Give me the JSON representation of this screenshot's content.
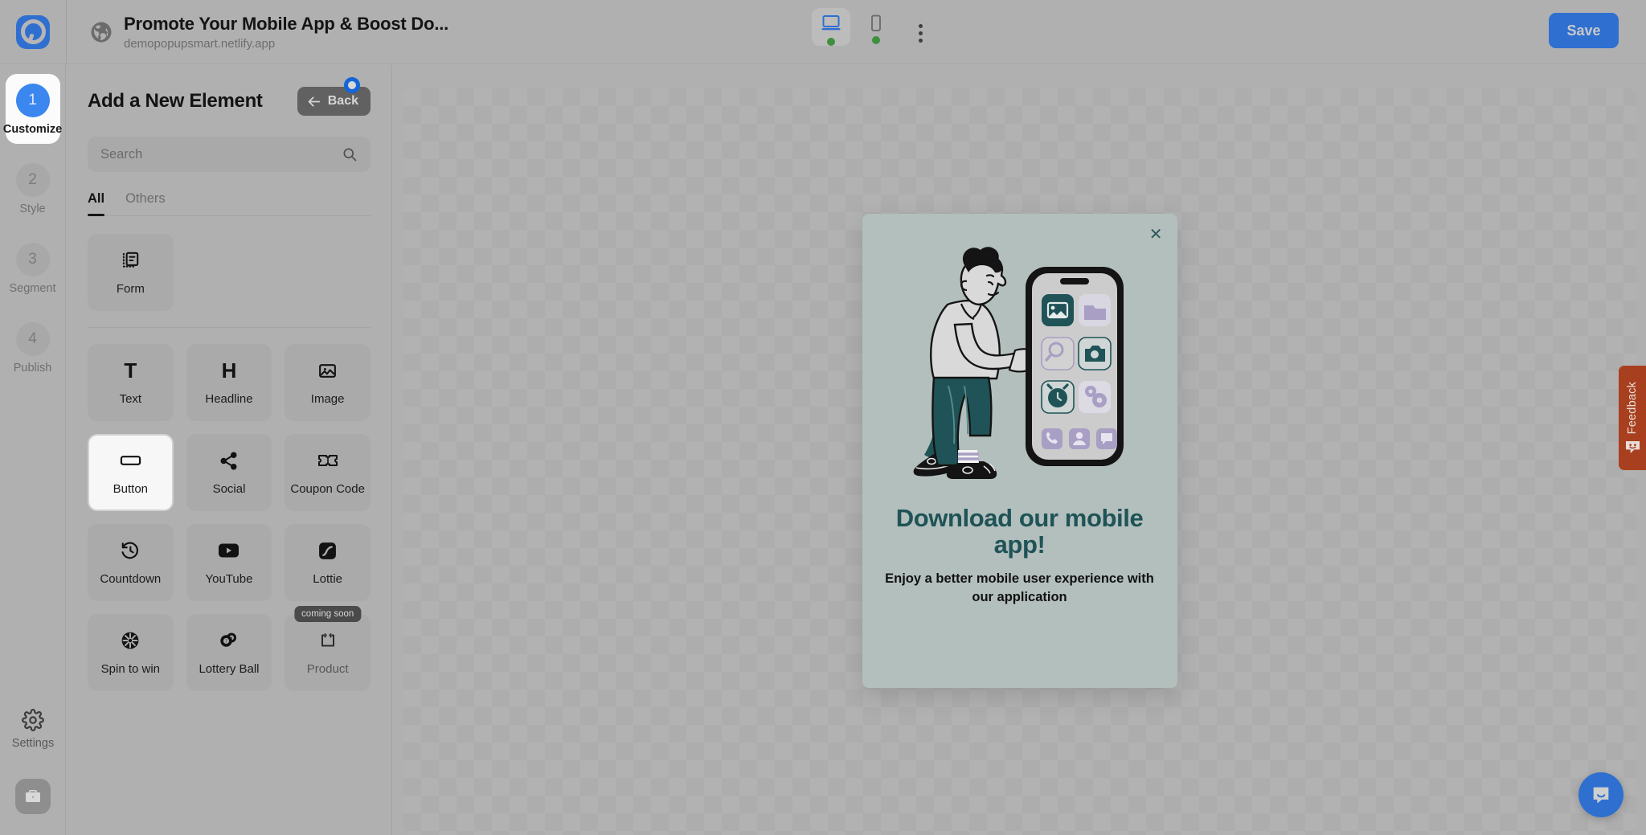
{
  "topbar": {
    "logo_icon": "popupsmart-logo-icon",
    "globe_icon": "globe-icon",
    "site_title": "Promote Your Mobile App & Boost Do...",
    "site_url": "demopopupsmart.netlify.app",
    "devices": [
      {
        "name": "desktop",
        "icon": "desktop-icon",
        "active": true,
        "status": "online"
      },
      {
        "name": "mobile",
        "icon": "mobile-icon",
        "active": false,
        "status": "online"
      }
    ],
    "more_icon": "kebab-menu-icon",
    "save_label": "Save",
    "save_color": "#2f6fd0"
  },
  "rail": {
    "steps": [
      {
        "num": "1",
        "label": "Customize",
        "active": true
      },
      {
        "num": "2",
        "label": "Style",
        "active": false
      },
      {
        "num": "3",
        "label": "Segment",
        "active": false
      },
      {
        "num": "4",
        "label": "Publish",
        "active": false
      }
    ],
    "settings_label": "Settings",
    "settings_icon": "gear-icon",
    "briefcase_icon": "briefcase-icon",
    "active_color": "#3b86ef"
  },
  "panel": {
    "title": "Add a New Element",
    "back_label": "Back",
    "back_icon": "arrow-left-icon",
    "search_value": "",
    "search_placeholder": "Search",
    "search_icon": "search-icon",
    "tabs": [
      {
        "label": "All",
        "active": true
      },
      {
        "label": "Others",
        "active": false
      }
    ],
    "form_group": [
      {
        "label": "Form",
        "icon": "form-icon",
        "selected": false,
        "badge": ""
      }
    ],
    "elements": [
      {
        "label": "Text",
        "icon": "text-t-icon",
        "selected": false,
        "badge": ""
      },
      {
        "label": "Headline",
        "icon": "headline-h-icon",
        "selected": false,
        "badge": ""
      },
      {
        "label": "Image",
        "icon": "image-icon",
        "selected": false,
        "badge": ""
      },
      {
        "label": "Button",
        "icon": "button-icon",
        "selected": true,
        "badge": ""
      },
      {
        "label": "Social",
        "icon": "share-icon",
        "selected": false,
        "badge": ""
      },
      {
        "label": "Coupon Code",
        "icon": "ticket-icon",
        "selected": false,
        "badge": ""
      },
      {
        "label": "Countdown",
        "icon": "countdown-clock-icon",
        "selected": false,
        "badge": ""
      },
      {
        "label": "YouTube",
        "icon": "youtube-icon",
        "selected": false,
        "badge": ""
      },
      {
        "label": "Lottie",
        "icon": "lottie-icon",
        "selected": false,
        "badge": ""
      },
      {
        "label": "Spin to win",
        "icon": "spin-wheel-icon",
        "selected": false,
        "badge": ""
      },
      {
        "label": "Lottery Ball",
        "icon": "lottery-ball-icon",
        "selected": false,
        "badge": ""
      },
      {
        "label": "Product",
        "icon": "product-icon",
        "selected": false,
        "badge": "coming soon"
      }
    ]
  },
  "popup": {
    "close_icon": "close-x-icon",
    "illustration": "man-tapping-phone-app-icons-illustration",
    "headline": "Download our mobile app!",
    "subtext": "Enjoy a better mobile user experience with our application",
    "background_color": "#b3bfbd",
    "headline_color": "#1f5357",
    "accent_teal": "#1f5357",
    "accent_purple": "#a99ec4"
  },
  "feedback": {
    "label": "Feedback",
    "icon": "smiley-chat-icon",
    "color": "#a8401f"
  },
  "intercom": {
    "icon": "chat-bubble-icon",
    "color": "#2f6fd0"
  }
}
